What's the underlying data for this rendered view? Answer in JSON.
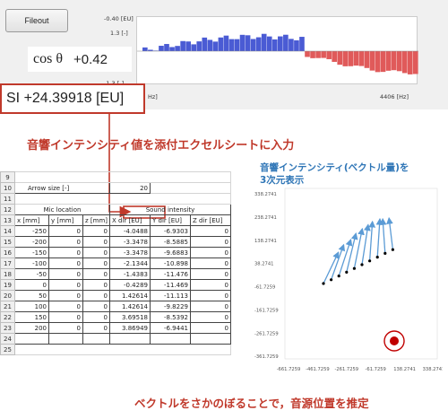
{
  "top_panel": {
    "fileout_label": "Fileout",
    "axis_top": "-0.40 [EU]",
    "axis_one": "1.3 [-]",
    "axis_neg": "-1.3 [-]",
    "axis_hz_left": "Hz]",
    "axis_hz_right": "4406 [Hz]",
    "cos_label": "cos θ",
    "cos_value": "+0.42",
    "si_text": "SI +24.39918 [EU]",
    "bar_colors": {
      "positive": "#4a5bd4",
      "negative": "#e05a5a"
    }
  },
  "annotations": {
    "input": "音響インテンシティ値を添付エクセルシートに入力",
    "display_line1": "音響インテンシティ(ベクトル量)を",
    "display_line2": "3次元表示",
    "estimate": "ベクトルをさかのぼることで，音源位置を推定"
  },
  "sheet": {
    "arrow_label": "Arrow size [-]",
    "arrow_value": "20",
    "mic_header": "Mic location",
    "si_header": "Sound intensity",
    "col_headers": [
      "x [mm]",
      "y [mm]",
      "z [mm]",
      "X dir [EU]",
      "Y dir [EU]",
      "Z dir [EU]"
    ],
    "data_rows": [
      {
        "row": "14",
        "cells": [
          "-250",
          "0",
          "0",
          "-4.0488",
          "-6.9303",
          "0"
        ]
      },
      {
        "row": "15",
        "cells": [
          "-200",
          "0",
          "0",
          "-3.3478",
          "-8.5885",
          "0"
        ]
      },
      {
        "row": "16",
        "cells": [
          "-150",
          "0",
          "0",
          "-3.3478",
          "-9.6883",
          "0"
        ]
      },
      {
        "row": "17",
        "cells": [
          "-100",
          "0",
          "0",
          "-2.1344",
          "-10.898",
          "0"
        ]
      },
      {
        "row": "18",
        "cells": [
          "-50",
          "0",
          "0",
          "-1.4383",
          "-11.476",
          "0"
        ]
      },
      {
        "row": "19",
        "cells": [
          "0",
          "0",
          "0",
          "-0.4289",
          "-11.469",
          "0"
        ]
      },
      {
        "row": "20",
        "cells": [
          "50",
          "0",
          "0",
          "1.42614",
          "-11.113",
          "0"
        ]
      },
      {
        "row": "21",
        "cells": [
          "100",
          "0",
          "0",
          "1.42614",
          "-9.8229",
          "0"
        ]
      },
      {
        "row": "22",
        "cells": [
          "150",
          "0",
          "0",
          "3.69518",
          "-8.5392",
          "0"
        ]
      },
      {
        "row": "23",
        "cells": [
          "200",
          "0",
          "0",
          "3.86949",
          "-6.9441",
          "0"
        ]
      }
    ]
  },
  "plot3d": {
    "y_ticks": [
      "338.2741",
      "238.2741",
      "138.2741",
      "38.2741",
      "-61.7259",
      "-161.7259",
      "-261.7259",
      "-361.7259"
    ],
    "x_ticks": [
      "-661.7259",
      "-461.7259",
      "-261.7259",
      "-61.7259",
      "138.2741",
      "338.2741"
    ],
    "arrow_color": "#5b9bd5",
    "source_color": "#c00000"
  }
}
